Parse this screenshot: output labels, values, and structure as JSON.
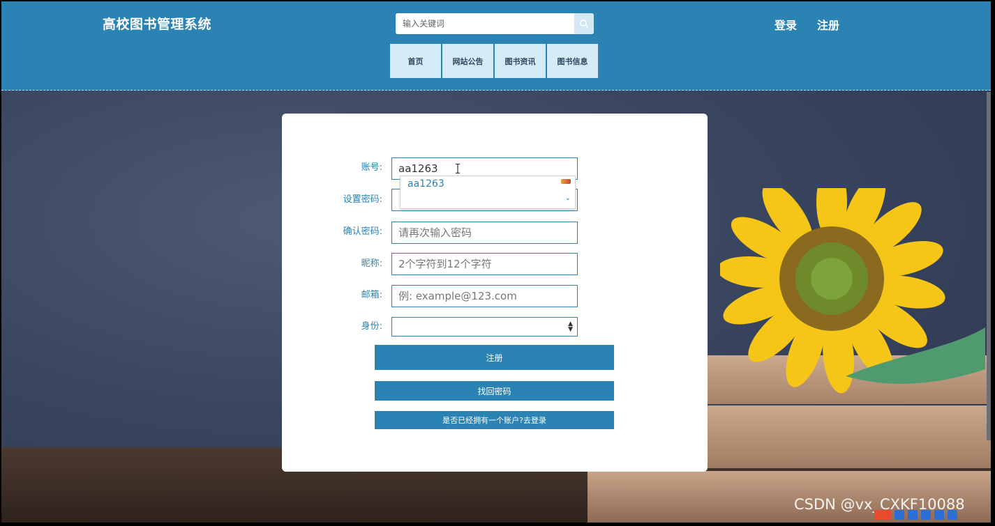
{
  "header": {
    "site_title": "高校图书管理系统",
    "search_placeholder": "输入关键词",
    "nav": [
      "首页",
      "网站公告",
      "图书资讯",
      "图书信息"
    ],
    "login_label": "登录",
    "register_label": "注册"
  },
  "form": {
    "account_label": "账号:",
    "account_value": "aa1263",
    "autocomplete_suggestion": "aa1263",
    "password_label": "设置密码:",
    "confirm_label": "确认密码:",
    "confirm_placeholder": "请再次输入密码",
    "nickname_label": "昵称:",
    "nickname_placeholder": "2个字符到12个字符",
    "email_label": "邮箱:",
    "email_placeholder": "例: example@123.com",
    "role_label": "身份:",
    "register_button": "注册",
    "find_password_button": "找回密码",
    "login_link_button": "是否已经拥有一个账户?去登录"
  },
  "watermark": "CSDN @vx_CXKF10088",
  "colors": {
    "primary": "#2a83b3",
    "nav_bg": "#d6ebf8"
  }
}
